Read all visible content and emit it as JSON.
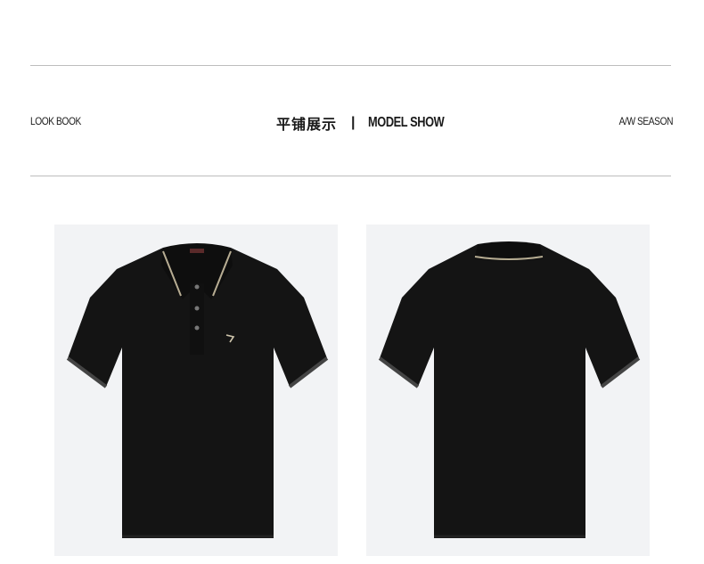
{
  "header": {
    "left_label": "LOOK BOOK",
    "title_cn": "平铺展示",
    "separator": "|",
    "title_en": "MODEL SHOW",
    "right_label": "A/W SEASON"
  },
  "gallery": {
    "items": [
      {
        "view": "front",
        "icon": "polo-shirt-front-image"
      },
      {
        "view": "back",
        "icon": "polo-shirt-back-image"
      }
    ]
  },
  "colors": {
    "shirt": "#141414",
    "trim": "#b7ad93",
    "photo_bg": "#f2f3f5",
    "rule": "#bdbdbd"
  }
}
